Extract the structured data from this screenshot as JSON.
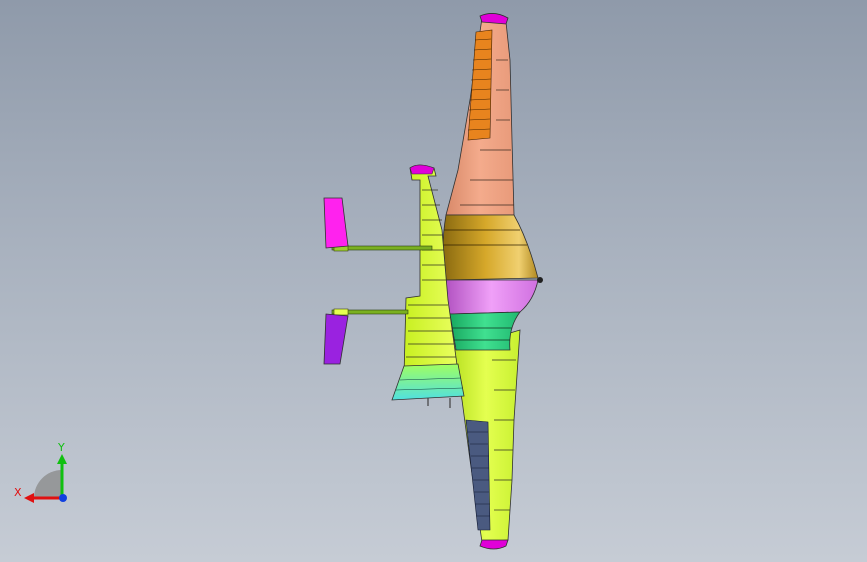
{
  "viewport": {
    "background_top": "#8f9aaa",
    "background_bottom": "#c6ccd5"
  },
  "model": {
    "parts": [
      {
        "name": "upper-wing",
        "color": "#f0a485"
      },
      {
        "name": "lower-wing",
        "color": "#d8ff3c"
      },
      {
        "name": "wingtip",
        "color": "#e000d8"
      },
      {
        "name": "fuselage-upper",
        "color": "#c79a1d"
      },
      {
        "name": "fuselage-canopy",
        "color": "#e57ef0"
      },
      {
        "name": "fuselage-lower",
        "color": "#2fd27e"
      },
      {
        "name": "vertical-fin",
        "color": "#d8ff3c"
      },
      {
        "name": "rudder-base",
        "color": "#7af0c0"
      },
      {
        "name": "tail-boom",
        "color": "#7ab020"
      },
      {
        "name": "upper-tail-surface",
        "color": "#ff22ee"
      },
      {
        "name": "lower-tail-surface",
        "color": "#9a22e0"
      }
    ]
  },
  "triad": {
    "x_label": "X",
    "y_label": "Y",
    "x_color": "#e01010",
    "y_color": "#10c010",
    "z_color": "#1040e0"
  }
}
